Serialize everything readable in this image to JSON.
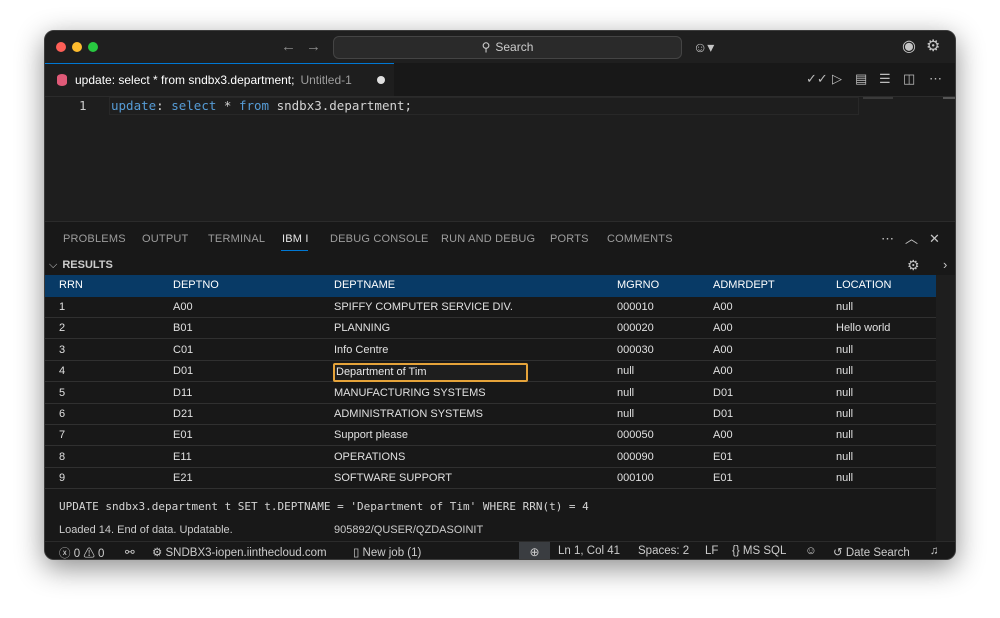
{
  "titlebar": {
    "search_label": "Search"
  },
  "editor_tab": {
    "title": "update: select * from sndbx3.department;",
    "subtitle": "Untitled-1"
  },
  "editor": {
    "line_number": "1",
    "code": {
      "kw1": "update",
      "colon": ":",
      "kw2": "select",
      "star": " * ",
      "kw3": "from",
      "rest": " sndbx3.department;"
    }
  },
  "panel": {
    "tabs": [
      "PROBLEMS",
      "OUTPUT",
      "TERMINAL",
      "IBM I",
      "DEBUG CONSOLE",
      "RUN AND DEBUG",
      "PORTS",
      "COMMENTS"
    ],
    "active_tab": "IBM I",
    "results_label": "RESULTS"
  },
  "table": {
    "columns": [
      "RRN",
      "DEPTNO",
      "DEPTNAME",
      "MGRNO",
      "ADMRDEPT",
      "LOCATION"
    ],
    "rows": [
      [
        "1",
        "A00",
        "SPIFFY COMPUTER SERVICE DIV.",
        "000010",
        "A00",
        "null"
      ],
      [
        "2",
        "B01",
        "PLANNING",
        "000020",
        "A00",
        "Hello world"
      ],
      [
        "3",
        "C01",
        "Info Centre",
        "000030",
        "A00",
        "null"
      ],
      [
        "4",
        "D01",
        "Department of Tim",
        "null",
        "A00",
        "null"
      ],
      [
        "5",
        "D11",
        "MANUFACTURING SYSTEMS",
        "null",
        "D01",
        "null"
      ],
      [
        "6",
        "D21",
        "ADMINISTRATION SYSTEMS",
        "null",
        "D01",
        "null"
      ],
      [
        "7",
        "E01",
        "Support please",
        "000050",
        "A00",
        "null"
      ],
      [
        "8",
        "E11",
        "OPERATIONS",
        "000090",
        "E01",
        "null"
      ],
      [
        "9",
        "E21",
        "SOFTWARE SUPPORT",
        "000100",
        "E01",
        "null"
      ]
    ],
    "editing_row": 3
  },
  "result_status": {
    "sql": "UPDATE sndbx3.department t SET t.DEPTNAME = 'Department of Tim' WHERE RRN(t) = 4",
    "loaded": "Loaded 14. End of data. Updatable.",
    "job": "905892/QUSER/QZDASOINIT"
  },
  "statusbar": {
    "errors": "0",
    "warnings": "0",
    "connection": "SNDBX3-iopen.iinthecloud.com",
    "job": "New job (1)",
    "position": "Ln 1, Col 41",
    "spaces": "Spaces: 2",
    "eol": "LF",
    "language": "MS SQL",
    "date_search": "Date Search"
  },
  "colors": {
    "accent": "#0078d4",
    "header_bg": "#083a66",
    "edit_border": "#e5a33a"
  }
}
